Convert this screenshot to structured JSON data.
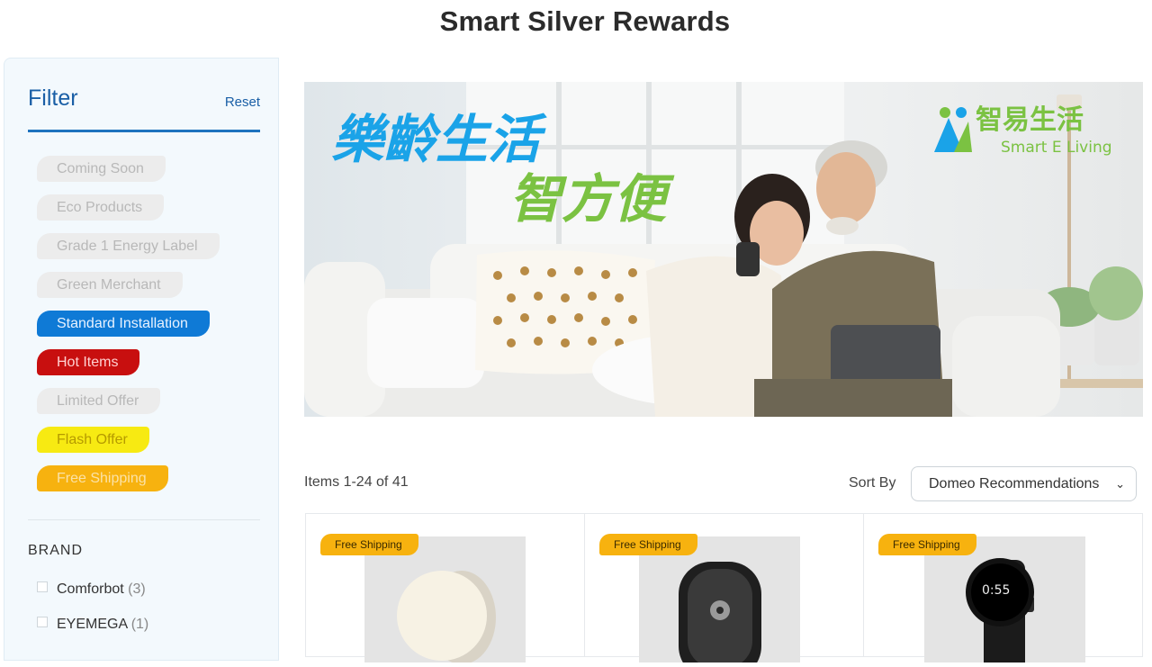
{
  "page": {
    "title": "Smart Silver Rewards"
  },
  "filter": {
    "title": "Filter",
    "reset_label": "Reset",
    "tags": [
      {
        "label": "Coming Soon",
        "style": "grey"
      },
      {
        "label": "Eco Products",
        "style": "grey"
      },
      {
        "label": "Grade 1 Energy Label",
        "style": "grey"
      },
      {
        "label": "Green Merchant",
        "style": "grey"
      },
      {
        "label": "Standard Installation",
        "style": "blue"
      },
      {
        "label": "Hot Items",
        "style": "red"
      },
      {
        "label": "Limited Offer",
        "style": "grey"
      },
      {
        "label": "Flash Offer",
        "style": "yellow"
      },
      {
        "label": "Free Shipping",
        "style": "orange"
      }
    ],
    "brand": {
      "title": "BRAND",
      "items": [
        {
          "name": "Comforbot",
          "count": "(3)"
        },
        {
          "name": "EYEMEGA",
          "count": "(1)"
        }
      ]
    }
  },
  "banner": {
    "headline_line1": "樂齡生活",
    "headline_line2": "智方便",
    "logo_cn": "智易生活",
    "logo_en": "Smart E Living",
    "colors": {
      "headline1": "#1aa3e8",
      "headline2": "#7bc242",
      "logo": "#7bc242"
    }
  },
  "listing": {
    "items_count": "Items 1-24 of 41",
    "sort_label": "Sort By",
    "sort_value": "Domeo Recommendations",
    "products": [
      {
        "badge": "Free Shipping",
        "icon": "round-sensor-device"
      },
      {
        "badge": "Free Shipping",
        "icon": "gps-tracker-device"
      },
      {
        "badge": "Free Shipping",
        "icon": "smartwatch",
        "watch_time": "0:55"
      }
    ]
  },
  "colors": {
    "accent": "#1e73be",
    "hot": "#c80f0f",
    "flash": "#f7ea12",
    "shipping": "#f7b20f"
  }
}
